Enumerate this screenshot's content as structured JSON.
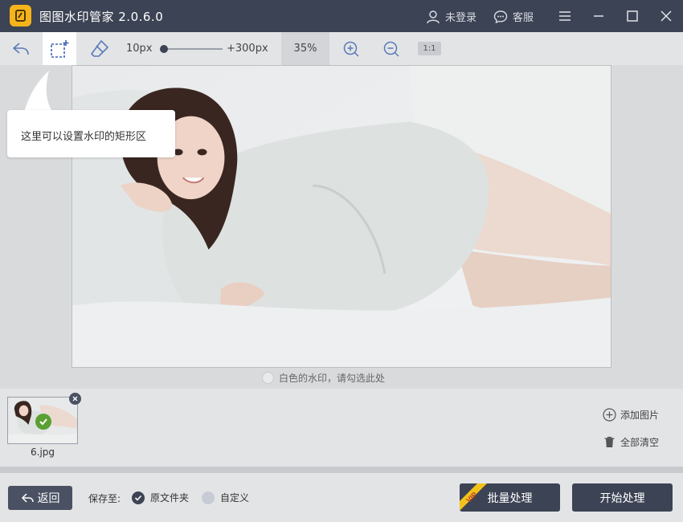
{
  "app": {
    "title": "图图水印管家  2.0.6.0",
    "user_label": "未登录",
    "service_label": "客服",
    "icons": [
      "app-logo-icon",
      "user-icon",
      "chat-icon",
      "menu-icon",
      "minimize-icon",
      "maximize-icon",
      "close-icon"
    ]
  },
  "toolbar": {
    "size_min": "10px",
    "size_max": "+300px",
    "brush_size_fraction": 0.0,
    "zoom": "35%",
    "one_to_one": "1:1",
    "icons": [
      "undo-icon",
      "rect-select-icon",
      "eraser-icon",
      "zoom-in-icon",
      "zoom-out-icon"
    ]
  },
  "tooltip": {
    "text": "这里可以设置水印的矩形区"
  },
  "canvas": {
    "white_watermark_label": "白色的水印，请勾选此处"
  },
  "files": {
    "items": [
      {
        "name": "6.jpg",
        "checked": true
      }
    ],
    "add_label": "添加图片",
    "clear_label": "全部清空"
  },
  "bottom": {
    "back_label": "返回",
    "save_to_label": "保存至:",
    "option_original": "原文件夹",
    "option_custom": "自定义",
    "selected_option": "原文件夹",
    "batch_label": "批量处理",
    "vip_label": "VIP",
    "start_label": "开始处理"
  },
  "colors": {
    "titlebar": "#3c4354",
    "logo": "#f5b41a",
    "check_green": "#5aa032",
    "vip_yellow": "#f2c21b"
  }
}
